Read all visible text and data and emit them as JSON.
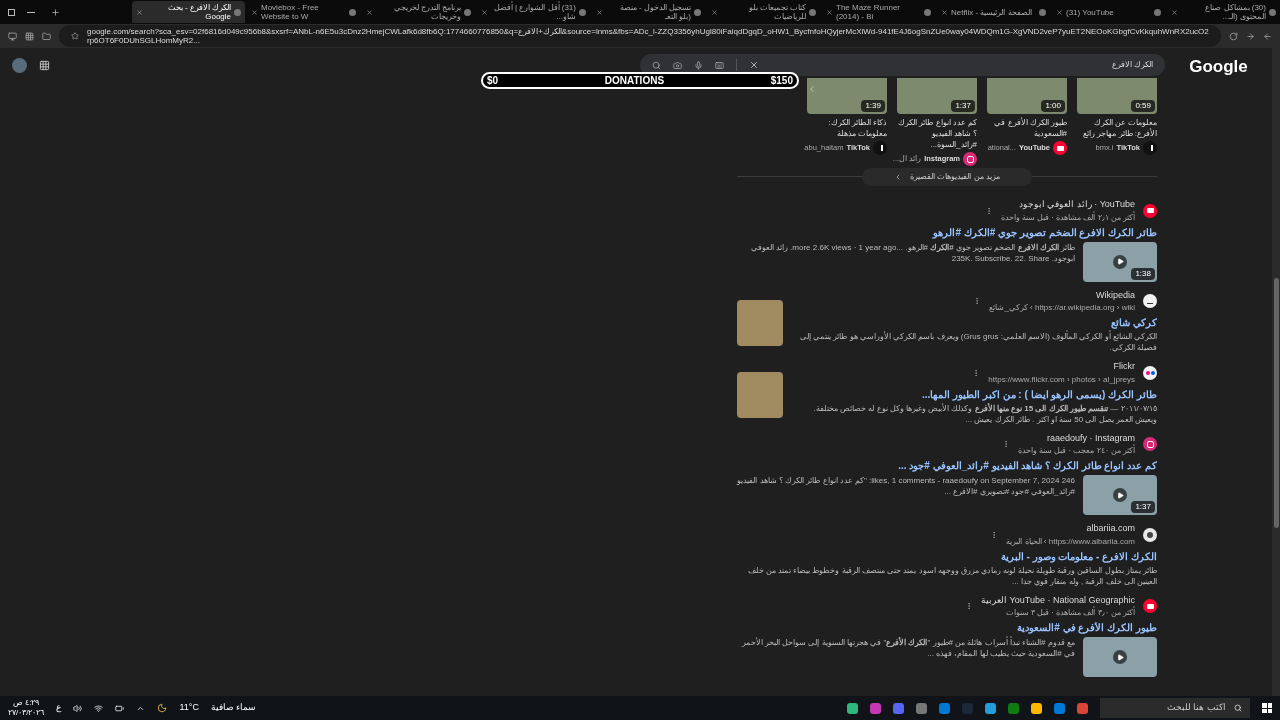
{
  "tabs": [
    {
      "title": "(30) بمشاكل صناع المحتوى (الـ...",
      "selected": false
    },
    {
      "title": "(31) YouTube",
      "selected": false
    },
    {
      "title": "Netflix - الصفحة الرئيسية",
      "selected": false
    },
    {
      "title": "The Maze Runner (2014) - Bi",
      "selected": false
    },
    {
      "title": "كتاب تجميعات بلو للرياضيات",
      "selected": false
    },
    {
      "title": "تسجيل الدخول - منصة (بلو التعـ",
      "selected": false
    },
    {
      "title": "(31) أقل الشوارع | أفضل شاو...",
      "selected": false
    },
    {
      "title": "برنامج التدرج لخريجي وخريجات",
      "selected": false
    },
    {
      "title": "Moviebox - Free Website to W",
      "selected": false
    },
    {
      "title": "الكرك الافرع - بحث Google",
      "selected": true
    }
  ],
  "address_bar": {
    "url": "google.com/search?sca_esv=02f6816d049c956b8&sxsrf=ANbL-n6E5u3cDnz2HmejCWLafk6d8fb6Q:1774660776850&q=الكرك+الافرع&source=lnms&fbs=ADc_l-ZZQ3356yhUgl80iFaiqdDgqD_oHW1_BycfnfoHQyjerMcXiWd-941fE4J6ogSnZUe0way04WDQm1G-XgVND2veP7yuET2NEOoKGbgfCvKkquhWnRX2ucO2rp6OT6F0DUhSGLHomMyR2..."
  },
  "search": {
    "query": "الكرك الافرع",
    "logo": "Google"
  },
  "donations": {
    "min": "$0",
    "label": "DONATIONS",
    "max": "$150",
    "level": 0
  },
  "short_videos": [
    {
      "duration": "0:59",
      "title": "معلومات عن الكرك الأفرع: طائر مهاجر رائع",
      "author": "bmx.i",
      "platform": "TikTok",
      "kind": "tiktok"
    },
    {
      "duration": "1:00",
      "title": "طيور الكرك الأفرع في #السعودية",
      "author": "...ational",
      "platform": "YouTube",
      "kind": "youtube"
    },
    {
      "duration": "1:37",
      "title": "كم عدد انواع طائر الكرك ؟ شاهد الفيديو #رائد_السوة...",
      "author": "رائد ال...",
      "platform": "Instagram",
      "kind": "instagram"
    },
    {
      "duration": "1:39",
      "title": "ذكاء الطائر الكرك: معلومات مذهلة",
      "author": "abu_haitam",
      "platform": "TikTok",
      "kind": "tiktok"
    }
  ],
  "more_videos": "مزيد من الفيديوهات القصيرة",
  "results": [
    {
      "kind": "youtube",
      "source": "YouTube · رائد العوفي ابوجود",
      "meta": "أكثر من ٢٫١ ألف مشاهدة · قبل سنة واحدة",
      "title": "طائر الكرك الافرع الضخم تصوير جوي #الكرك #الرهو",
      "snippet": "طائر **الكرك الافرع** الضخم تصوير جوي **#الكرك** #الرهو. ...more 2.6K views · 1 year ago. رائد العوفي ابوجود. 235K. Subscribe. 22. Share",
      "thumbnail": {
        "kind": "video",
        "duration": "1:38"
      }
    },
    {
      "kind": "wikipedia",
      "source": "Wikipedia",
      "meta": "https://ar.wikipedia.org › wiki › كركي_شائع",
      "title": "كركي شائع",
      "snippet": "الكركي الشائع أو الكركي المألوف (الاسم العلمي: Grus grus) ويعرف باسم الكركي الأوراسي هو طائر ينتمي إلى فصيلة الكركي.",
      "thumbnail": {
        "kind": "image"
      }
    },
    {
      "kind": "flickr",
      "source": "Flickr",
      "meta": "https://www.flickr.com › photos › al_jpreys",
      "title": "طائر الكرك (يسمى الرهو ايضا ) : من اكبر الطيور المها...",
      "snippet": "٢٠١١/٠٧/١٥ — **تنقسم طيور الكرك الى 15 نوع منها الأفرع** وكذلك الأبيض وغيرها وكل نوع له خصائص مختلفة. ويعيش العمر يصل الى 50 سنة او اكثر . طائر الكرك يعيش ...",
      "thumbnail": {
        "kind": "image"
      }
    },
    {
      "kind": "instagram",
      "source": "raaedoufy · Instagram",
      "meta": "أكثر من ٢٤٠ معجب · قبل سنة واحدة",
      "title": "كم عدد انواع طائر الكرك ؟ شاهد الفيديو #رائد_العوفي #جود ...",
      "snippet": "246 likes, 1 comments - raaedoufy on September 7, 2024: \"كم عدد انواع طائر الكرك ؟ شاهد الفيديو #رائد_العوفي #جود #تصويري #الافرع ...",
      "thumbnail": {
        "kind": "video",
        "duration": "1:37"
      }
    },
    {
      "kind": "site",
      "source": "albariia.com",
      "meta": "https://www.albariia.com › الحياة البرية",
      "title": "الكرك الافرع - معلومات وصور - البرية",
      "snippet": "طائر يمتاز بطول الساقين ورقبة طويلة نحيلة لونه رمادي مزرق ووجهه اسود يمتد حتى منتصف الرقبة وخطوط بيضاء تمتد من خلف العينين الى خلف الرقبة , وله منقار قوي جدا ..."
    },
    {
      "kind": "youtube",
      "source": "YouTube · National Geographic العربية",
      "meta": "أكثر من ٣٫٠ ألف مشاهدة · قبل ٣ سنوات",
      "title": "طيور الكرك الأفرع في #السعودية",
      "snippet": "مع قدوم #الشتاء تبدأ أسراب هائلة من #طيور \"**الكرك الأفرع**\" في هجرتها السنوية إلى سواحل البحر الأحمر في #السعودية حيث يطيب لها المقام، فهذه ...",
      "thumbnail": {
        "kind": "video"
      }
    }
  ],
  "taskbar": {
    "search_placeholder": "اكتب هنا للبحث",
    "weather_temp": "11°C",
    "weather_text": "سماء صافية",
    "language": "ع",
    "time": "٤:٢٩ ص",
    "date": "٢٧/٠٣/٢٠٢٦"
  }
}
